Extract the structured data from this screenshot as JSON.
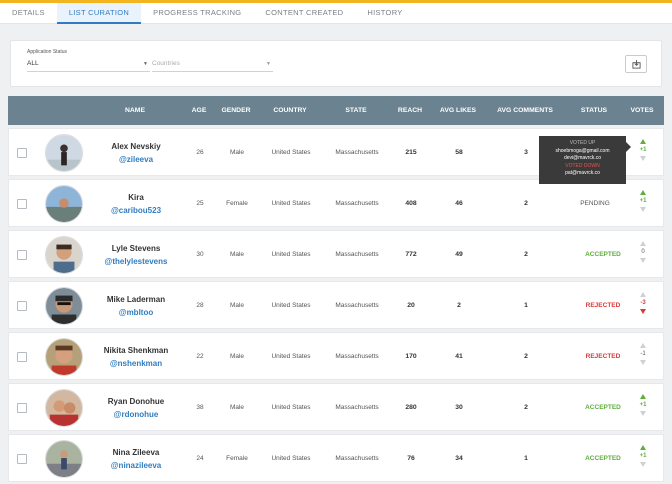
{
  "tabs": [
    {
      "label": "DETAILS"
    },
    {
      "label": "LIST CURATION"
    },
    {
      "label": "PROGRESS TRACKING"
    },
    {
      "label": "CONTENT CREATED"
    },
    {
      "label": "HISTORY"
    }
  ],
  "filters": {
    "status_label": "Application Status",
    "status_value": "ALL",
    "countries_placeholder": "Countries"
  },
  "table": {
    "headers": {
      "name": "NAME",
      "age": "AGE",
      "gender": "GENDER",
      "country": "COUNTRY",
      "state": "STATE",
      "reach": "REACH",
      "avg_likes": "AVG LIKES",
      "avg_comments": "AVG COMMENTS",
      "status": "STATUS",
      "votes": "VOTES"
    },
    "rows": [
      {
        "name": "Alex Nevskiy",
        "handle": "@zileeva",
        "age": "26",
        "gender": "Male",
        "country": "United States",
        "state": "Massachusetts",
        "reach": "215",
        "avg_likes": "58",
        "avg_comments": "3",
        "status": "",
        "votes": "+1"
      },
      {
        "name": "Kira",
        "handle": "@caribou523",
        "age": "25",
        "gender": "Female",
        "country": "United States",
        "state": "Massachusetts",
        "reach": "408",
        "avg_likes": "46",
        "avg_comments": "2",
        "status": "PENDING",
        "votes": "+1"
      },
      {
        "name": "Lyle Stevens",
        "handle": "@thelylestevens",
        "age": "30",
        "gender": "Male",
        "country": "United States",
        "state": "Massachusetts",
        "reach": "772",
        "avg_likes": "49",
        "avg_comments": "2",
        "status": "ACCEPTED",
        "votes": "0"
      },
      {
        "name": "Mike Laderman",
        "handle": "@mbltoo",
        "age": "28",
        "gender": "Male",
        "country": "United States",
        "state": "Massachusetts",
        "reach": "20",
        "avg_likes": "2",
        "avg_comments": "1",
        "status": "REJECTED",
        "votes": "-3"
      },
      {
        "name": "Nikita Shenkman",
        "handle": "@nshenkman",
        "age": "22",
        "gender": "Male",
        "country": "United States",
        "state": "Massachusetts",
        "reach": "170",
        "avg_likes": "41",
        "avg_comments": "2",
        "status": "REJECTED",
        "votes": "-1"
      },
      {
        "name": "Ryan Donohue",
        "handle": "@rdonohue",
        "age": "38",
        "gender": "Male",
        "country": "United States",
        "state": "Massachusetts",
        "reach": "280",
        "avg_likes": "30",
        "avg_comments": "2",
        "status": "ACCEPTED",
        "votes": "+1"
      },
      {
        "name": "Nina Zileeva",
        "handle": "@ninazileeva",
        "age": "24",
        "gender": "Female",
        "country": "United States",
        "state": "Massachusetts",
        "reach": "76",
        "avg_likes": "34",
        "avg_comments": "1",
        "status": "ACCEPTED",
        "votes": "+1"
      }
    ]
  },
  "tooltip": {
    "heading": "VOTED UP",
    "lines": [
      "shoebmoga@gmail.com",
      "devi@mavrck.co"
    ],
    "down_heading": "VOTED DOWN",
    "down_lines": [
      "pat@mavrck.co"
    ]
  },
  "colors": {
    "accent": "#2f7dc0",
    "header": "#6b8290",
    "accepted": "#5fae3f",
    "rejected": "#d93a3a",
    "top_strip": "#f2b41f"
  }
}
